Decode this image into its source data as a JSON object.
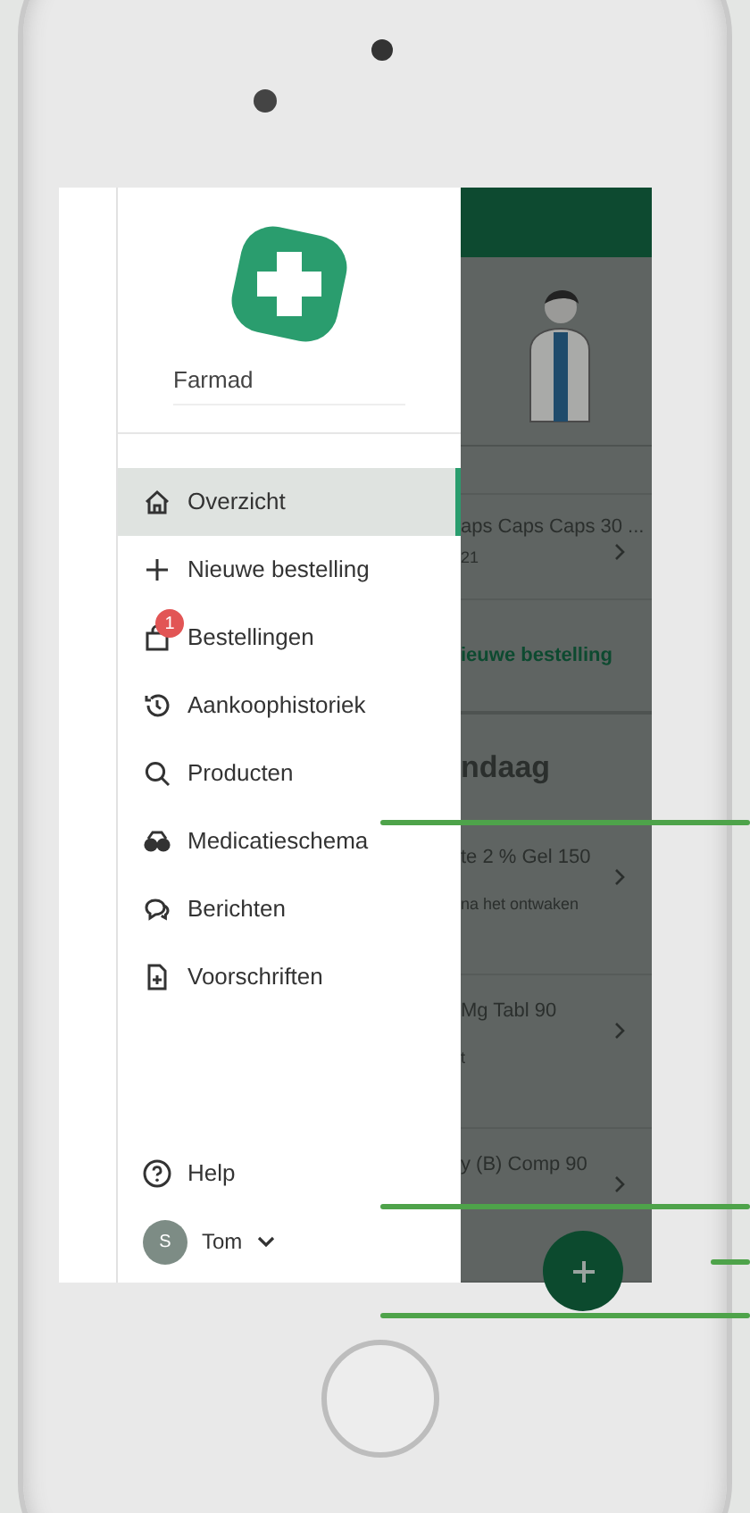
{
  "drawer": {
    "brand": "Farmad",
    "menu": [
      {
        "label": "Overzicht",
        "selected": true
      },
      {
        "label": "Nieuwe bestelling",
        "selected": false
      },
      {
        "label": "Bestellingen",
        "selected": false,
        "badge": "1"
      },
      {
        "label": "Aankoophistoriek",
        "selected": false
      },
      {
        "label": "Producten",
        "selected": false
      },
      {
        "label": "Medicatieschema",
        "selected": false
      },
      {
        "label": "Berichten",
        "selected": false
      },
      {
        "label": "Voorschriften",
        "selected": false
      }
    ],
    "help": "Help",
    "user": {
      "initial": "S",
      "name": "Tom"
    }
  },
  "background": {
    "order_title": "aps Caps Caps 30 ...",
    "order_date": "21",
    "new_order_link": "ieuwe bestelling",
    "section_title": "ndaag",
    "items": [
      {
        "title": "te 2 % Gel 150",
        "note": "na het ontwaken"
      },
      {
        "title": "Mg Tabl 90",
        "note": "t"
      },
      {
        "title": "y (B) Comp 90"
      }
    ]
  }
}
